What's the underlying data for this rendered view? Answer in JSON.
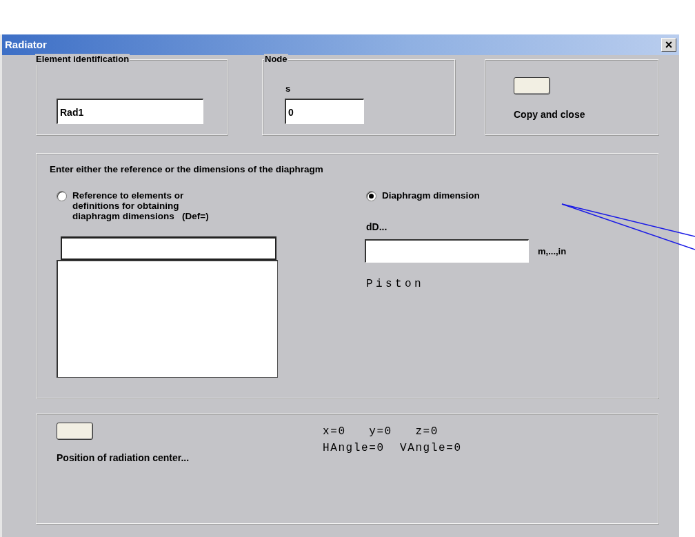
{
  "window": {
    "title": "Radiator",
    "close": "×"
  },
  "element_identification": {
    "label": "Element identification",
    "value": "Rad1"
  },
  "node": {
    "label": "Node",
    "field_label": "s",
    "value": "0"
  },
  "copy_and_close": {
    "label": "Copy and close"
  },
  "diaphragm": {
    "instruction": "Enter either the reference or the dimensions of the diaphragm",
    "options": [
      {
        "kind": "reference",
        "lines": [
          "Reference to elements or",
          "definitions for obtaining",
          "diaphragm dimensions   (Def=)"
        ],
        "selected": false
      },
      {
        "kind": "dimension",
        "lines": [
          "Diaphragm dimension"
        ],
        "selected": true
      }
    ],
    "dimension_label": "dD...",
    "unit": "m,...,in",
    "shape": "Piston"
  },
  "radiation_center": {
    "label": "Position of radiation center...",
    "coordinates": [
      "x=0   y=0   z=0",
      "HAngle=0  VAngle=0"
    ]
  }
}
